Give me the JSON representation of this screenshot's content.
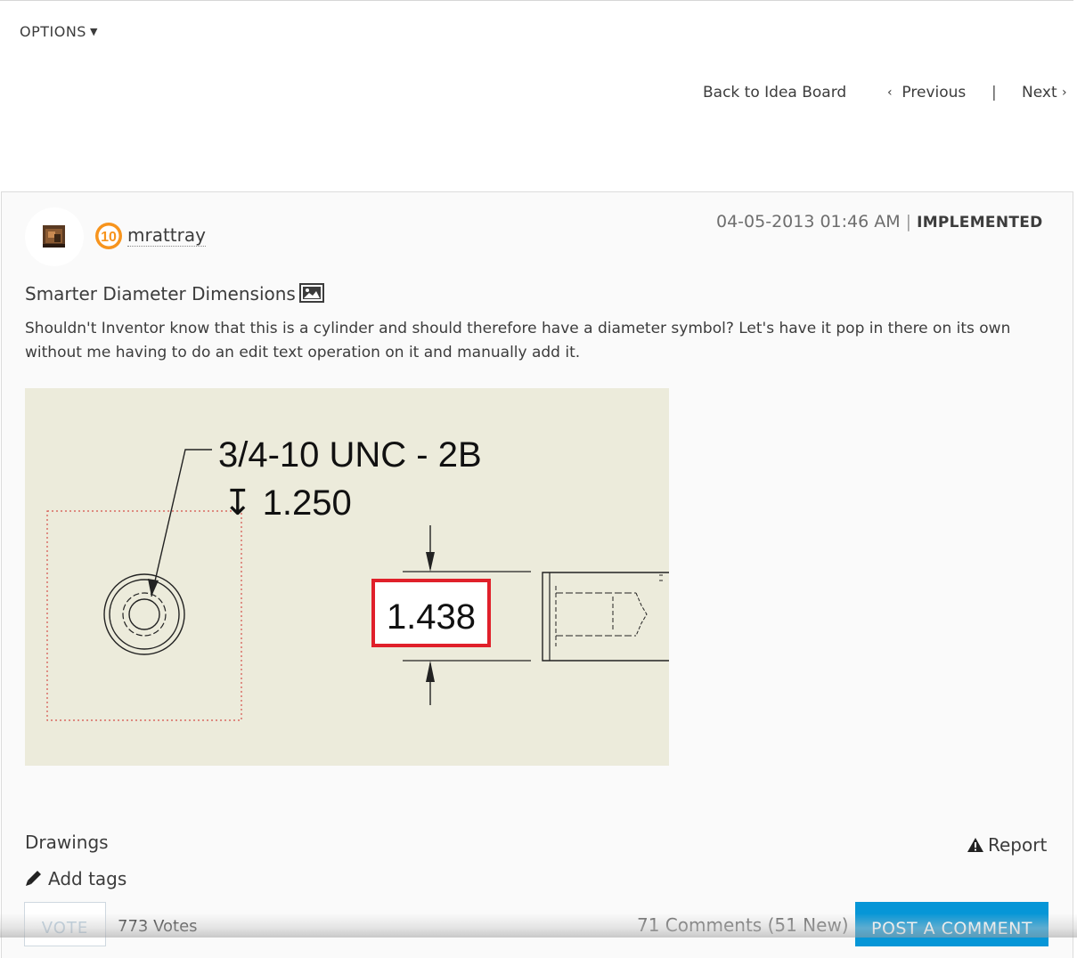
{
  "options": {
    "label": "OPTIONS"
  },
  "nav": {
    "back": "Back to Idea Board",
    "previous": "Previous",
    "separator": "|",
    "next": "Next"
  },
  "post": {
    "author": "mrattray",
    "rank_badge": "10",
    "date": "04-05-2013 01:46 AM",
    "separator": "|",
    "status": "IMPLEMENTED",
    "title": "Smarter Diameter Dimensions",
    "body": "Shouldn't Inventor know that this is a cylinder and should therefore have a diameter symbol? Let's have it pop in there on its own without me having to do an edit text operation on it and manually add it.",
    "image_text": {
      "thread": "3/4-10 UNC - 2B",
      "depth": "↧ 1.250",
      "dimension": "1.438"
    },
    "category": "Drawings",
    "report": "Report",
    "add_tags": "Add tags"
  },
  "footer": {
    "vote": "VOTE",
    "votes": "773 Votes",
    "comments": "71 Comments (51 New)",
    "post_comment": "POST A COMMENT"
  },
  "colors": {
    "accent": "#0696d7",
    "highlight_box": "#e0202a",
    "drawing_bg": "#ecebdb",
    "rank_badge": "#f7941d"
  },
  "icons": [
    "caret-down-icon",
    "chevron-left-icon",
    "chevron-right-icon",
    "image-icon",
    "warning-icon",
    "pencil-icon"
  ]
}
